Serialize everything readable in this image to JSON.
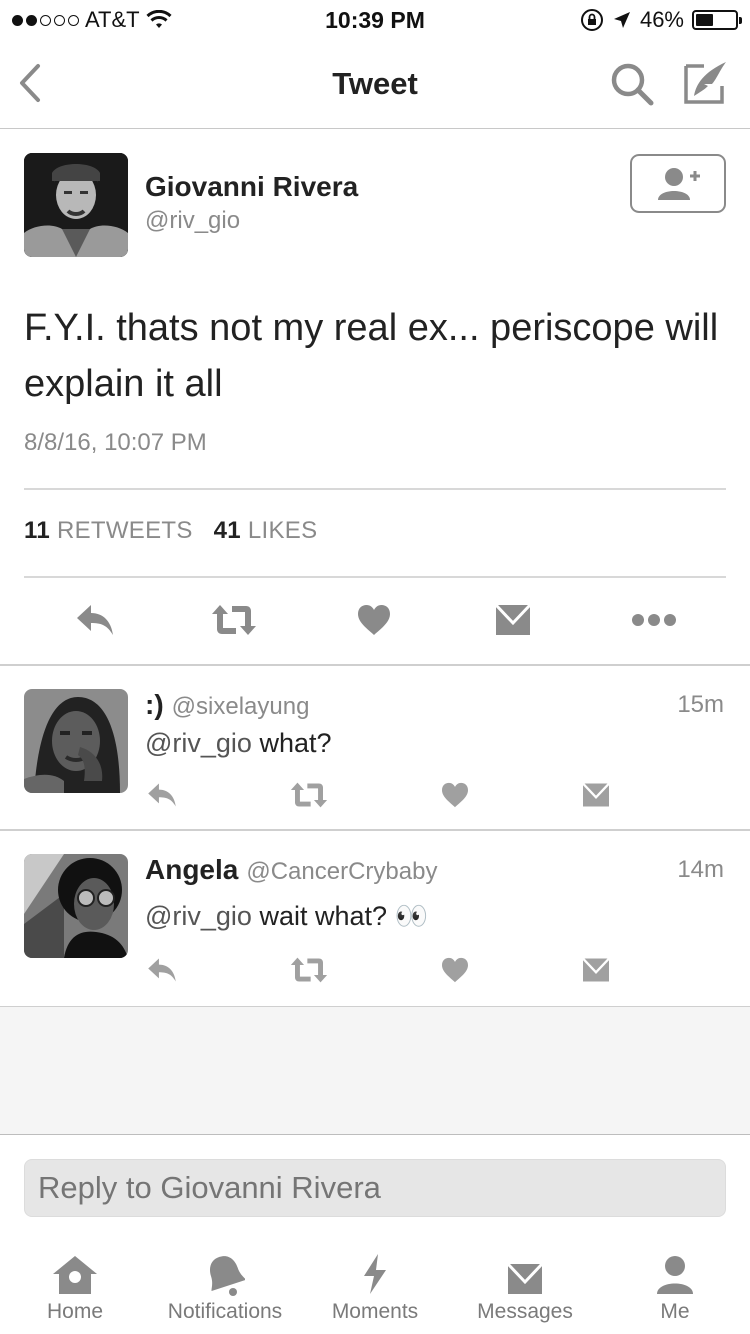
{
  "status_bar": {
    "carrier": "AT&T",
    "time": "10:39 PM",
    "battery": "46%",
    "battery_level": 0.46,
    "signal_bars_filled": 2,
    "signal_bars_total": 5
  },
  "nav": {
    "title": "Tweet",
    "icons": [
      "back-arrow-icon",
      "search-icon",
      "compose-icon"
    ]
  },
  "tweet": {
    "author_name": "Giovanni Rivera",
    "author_handle": "@riv_gio",
    "text": "F.Y.I. thats not my real ex... periscope will explain it all",
    "timestamp": "8/8/16, 10:07 PM",
    "retweets_count": "11",
    "retweets_label": "RETWEETS",
    "likes_count": "41",
    "likes_label": "LIKES"
  },
  "replies": [
    {
      "name": ":)",
      "handle": "@sixelayung",
      "ago": "15m",
      "mention": "@riv_gio",
      "text": " what?"
    },
    {
      "name": "Angela",
      "handle": "@CancerCrybaby",
      "ago": "14m",
      "mention": "@riv_gio",
      "text": " wait what? 👀"
    }
  ],
  "reply_box": {
    "placeholder": "Reply to Giovanni Rivera"
  },
  "tabs": [
    {
      "label": "Home",
      "icon": "home-icon"
    },
    {
      "label": "Notifications",
      "icon": "bell-icon"
    },
    {
      "label": "Moments",
      "icon": "lightning-icon"
    },
    {
      "label": "Messages",
      "icon": "envelope-icon"
    },
    {
      "label": "Me",
      "icon": "person-icon"
    }
  ],
  "colors": {
    "text_primary": "#222222",
    "text_secondary": "#8a8a8a",
    "icon_gray": "#8a8a8a",
    "divider": "#d8d8d8"
  }
}
